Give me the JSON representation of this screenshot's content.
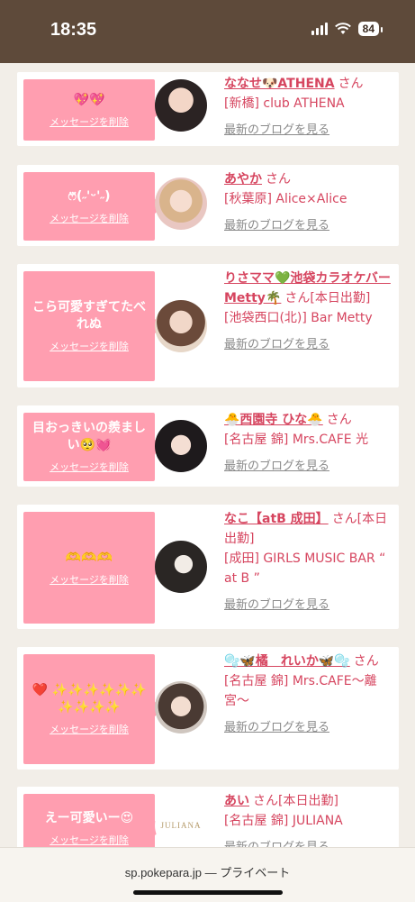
{
  "status_bar": {
    "time": "18:35",
    "battery": "84"
  },
  "cards": [
    {
      "message": "💖💖",
      "delete_label": "メッセージを削除",
      "name": "ななせ🐶ATHENA",
      "san": "さん",
      "shop": "[新橋] club ATHENA",
      "blog_label": "最新のブログを見る"
    },
    {
      "message": "ෆ⃛(˶'ᵕ'˶)",
      "delete_label": "メッセージを削除",
      "name": "あやか",
      "san": "さん",
      "shop": "[秋葉原] Alice×Alice",
      "blog_label": "最新のブログを見る"
    },
    {
      "message": "こら可愛すぎてたべれぬ",
      "delete_label": "メッセージを削除",
      "name": "りさママ💚池袋カラオケバーMetty🌴",
      "san": "さん[本日出勤]",
      "shop": "[池袋西口(北)] Bar Metty",
      "blog_label": "最新のブログを見る"
    },
    {
      "message": "目おっきいの羨ましい🥺💓",
      "delete_label": "メッセージを削除",
      "name": "🐣西園寺 ひな🐣",
      "san": "さん",
      "shop": "[名古屋 錦] Mrs.CAFE 光",
      "blog_label": "最新のブログを見る"
    },
    {
      "message": "🫶🫶🫶",
      "delete_label": "メッセージを削除",
      "name": "なこ【atB 成田】",
      "san": "さん[本日出勤]",
      "shop": "[成田] GIRLS MUSIC BAR “ at B ”",
      "blog_label": "最新のブログを見る"
    },
    {
      "message": "❤️ ✨✨✨✨✨✨ ✨✨✨✨",
      "delete_label": "メッセージを削除",
      "name": "🫧🦋橘　れいか🦋🫧",
      "san": "さん",
      "shop": "[名古屋 錦] Mrs.CAFE〜離宮〜",
      "blog_label": "最新のブログを見る"
    },
    {
      "message": "えー可愛いー😍",
      "delete_label": "メッセージを削除",
      "name": "あい",
      "san": "さん[本日出勤]",
      "shop": "[名古屋 錦] JULIANA",
      "blog_label": "最新のブログを見る",
      "logo_text": "JULIANA"
    }
  ],
  "url_bar": {
    "text": "sp.pokepara.jp — プライベート"
  },
  "colors": {
    "accent": "#d6455f",
    "pink_box": "#ff9eb0",
    "header": "#5e4a3a"
  }
}
